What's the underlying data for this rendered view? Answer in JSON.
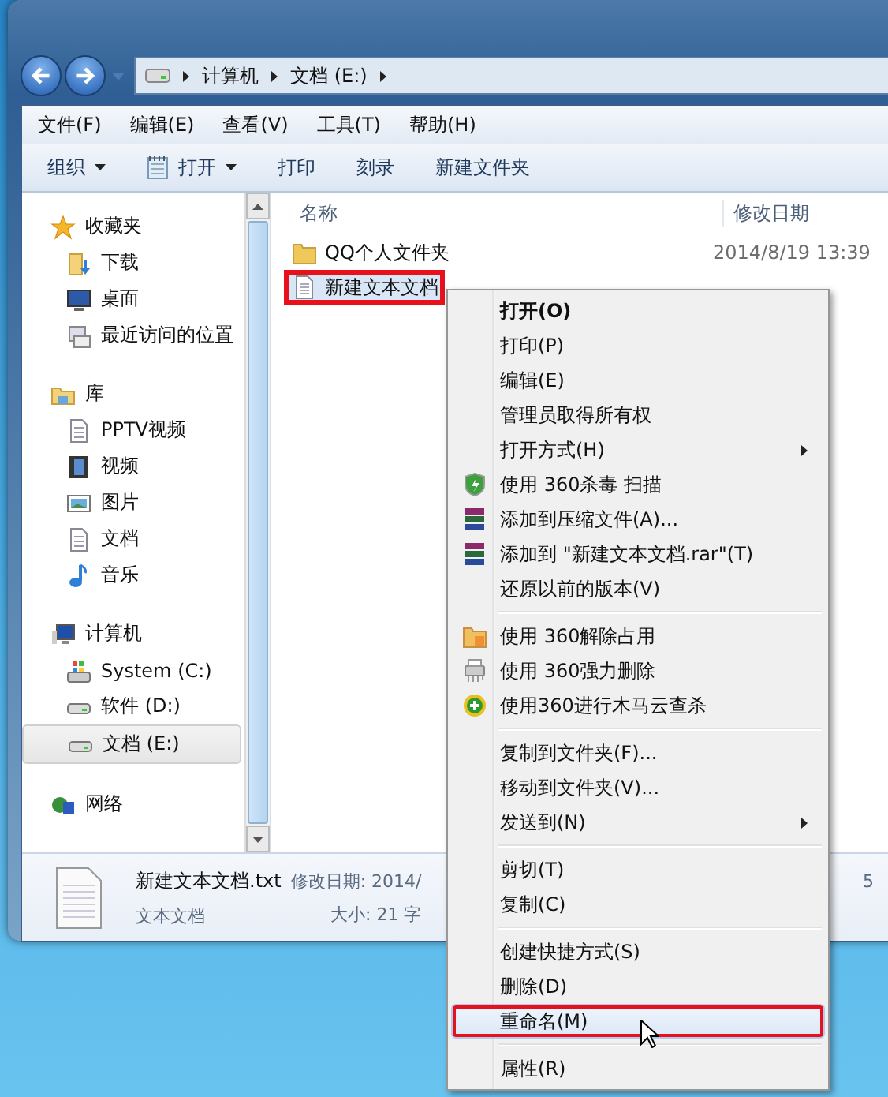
{
  "address": {
    "crumbs": [
      "计算机",
      "文档 (E:)"
    ]
  },
  "menu_bar": [
    "文件(F)",
    "编辑(E)",
    "查看(V)",
    "工具(T)",
    "帮助(H)"
  ],
  "toolbar": [
    {
      "label": "组织",
      "dropdown": true
    },
    {
      "label": "打开",
      "dropdown": true
    },
    {
      "label": "打印",
      "dropdown": false
    },
    {
      "label": "刻录",
      "dropdown": false
    },
    {
      "label": "新建文件夹",
      "dropdown": false
    }
  ],
  "sidebar": {
    "groups": [
      {
        "label": "收藏夹",
        "children": [
          {
            "label": "下载",
            "selected": false
          },
          {
            "label": "桌面",
            "selected": false
          },
          {
            "label": "最近访问的位置",
            "selected": false
          }
        ]
      },
      {
        "label": "库",
        "children": [
          {
            "label": "PPTV视频",
            "selected": false
          },
          {
            "label": "视频",
            "selected": false
          },
          {
            "label": "图片",
            "selected": false
          },
          {
            "label": "文档",
            "selected": false
          },
          {
            "label": "音乐",
            "selected": false
          }
        ]
      },
      {
        "label": "计算机",
        "children": [
          {
            "label": "System (C:)",
            "selected": false
          },
          {
            "label": "软件 (D:)",
            "selected": false
          },
          {
            "label": "文档 (E:)",
            "selected": true
          }
        ]
      },
      {
        "label": "网络"
      }
    ]
  },
  "file_list": {
    "columns": [
      "名称",
      "修改日期"
    ],
    "rows": [
      {
        "name": "QQ个人文件夹",
        "modified": "2014/8/19 13:39",
        "selected": false,
        "highlighted": false
      },
      {
        "name": "新建文本文档",
        "selected": true,
        "highlighted": true
      }
    ]
  },
  "details": {
    "name": "新建文本文档.txt",
    "type": "文本文档",
    "modified": "修改日期: 2014/",
    "size": "大小: 21 字",
    "fragment": "5"
  },
  "context_menu": [
    {
      "kind": "item",
      "label": "打开(O)",
      "bold": true,
      "submenu": false,
      "hovered": false,
      "highlighted": false
    },
    {
      "kind": "item",
      "label": "打印(P)",
      "bold": false,
      "submenu": false,
      "hovered": false,
      "highlighted": false
    },
    {
      "kind": "item",
      "label": "编辑(E)",
      "bold": false,
      "submenu": false,
      "hovered": false,
      "highlighted": false
    },
    {
      "kind": "item",
      "label": "管理员取得所有权",
      "bold": false,
      "submenu": false,
      "hovered": false,
      "highlighted": false
    },
    {
      "kind": "item",
      "label": "打开方式(H)",
      "bold": false,
      "submenu": true,
      "hovered": false,
      "highlighted": false
    },
    {
      "kind": "item",
      "label": "使用 360杀毒 扫描",
      "bold": false,
      "submenu": false,
      "hovered": false,
      "highlighted": false
    },
    {
      "kind": "item",
      "label": "添加到压缩文件(A)...",
      "bold": false,
      "submenu": false,
      "hovered": false,
      "highlighted": false
    },
    {
      "kind": "item",
      "label": "添加到 \"新建文本文档.rar\"(T)",
      "bold": false,
      "submenu": false,
      "hovered": false,
      "highlighted": false
    },
    {
      "kind": "item",
      "label": "还原以前的版本(V)",
      "bold": false,
      "submenu": false,
      "hovered": false,
      "highlighted": false
    },
    {
      "kind": "separator"
    },
    {
      "kind": "item",
      "label": "使用 360解除占用",
      "bold": false,
      "submenu": false,
      "hovered": false,
      "highlighted": false
    },
    {
      "kind": "item",
      "label": "使用 360强力删除",
      "bold": false,
      "submenu": false,
      "hovered": false,
      "highlighted": false
    },
    {
      "kind": "item",
      "label": "使用360进行木马云查杀",
      "bold": false,
      "submenu": false,
      "hovered": false,
      "highlighted": false
    },
    {
      "kind": "separator"
    },
    {
      "kind": "item",
      "label": "复制到文件夹(F)...",
      "bold": false,
      "submenu": false,
      "hovered": false,
      "highlighted": false
    },
    {
      "kind": "item",
      "label": "移动到文件夹(V)...",
      "bold": false,
      "submenu": false,
      "hovered": false,
      "highlighted": false
    },
    {
      "kind": "item",
      "label": "发送到(N)",
      "bold": false,
      "submenu": true,
      "hovered": false,
      "highlighted": false
    },
    {
      "kind": "separator"
    },
    {
      "kind": "item",
      "label": "剪切(T)",
      "bold": false,
      "submenu": false,
      "hovered": false,
      "highlighted": false
    },
    {
      "kind": "item",
      "label": "复制(C)",
      "bold": false,
      "submenu": false,
      "hovered": false,
      "highlighted": false
    },
    {
      "kind": "separator"
    },
    {
      "kind": "item",
      "label": "创建快捷方式(S)",
      "bold": false,
      "submenu": false,
      "hovered": false,
      "highlighted": false
    },
    {
      "kind": "item",
      "label": "删除(D)",
      "bold": false,
      "submenu": false,
      "hovered": false,
      "highlighted": false
    },
    {
      "kind": "item",
      "label": "重命名(M)",
      "bold": false,
      "submenu": false,
      "hovered": true,
      "highlighted": true
    },
    {
      "kind": "separator"
    },
    {
      "kind": "item",
      "label": "属性(R)",
      "bold": false,
      "submenu": false,
      "hovered": false,
      "highlighted": false
    }
  ]
}
